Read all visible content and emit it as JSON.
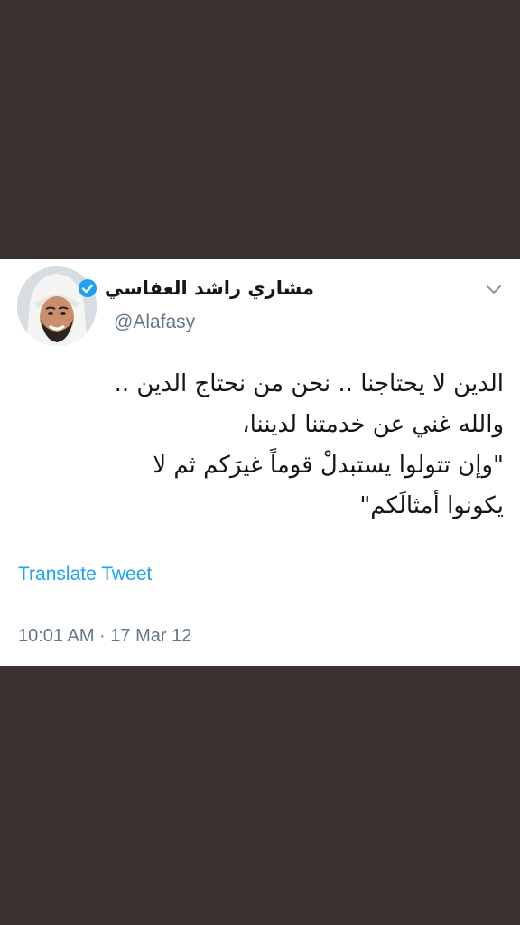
{
  "tweet": {
    "display_name": "مشاري راشد العفاسي",
    "handle": "@Alafasy",
    "verified_icon": "verified-badge-icon",
    "menu_icon": "chevron-down-icon",
    "body_lines": [
      "الدين لا يحتاجنا .. نحن من نحتاج الدين ..",
      "والله غني عن خدمتنا لديننا،",
      "\"وإن تتولوا يستبدلْ قوماً غيرَكم ثم لا",
      "يكونوا أمثالَكم\""
    ],
    "translate_label": "Translate Tweet",
    "timestamp": "10:01 AM · 17 Mar 12"
  },
  "colors": {
    "background": "#3a3230",
    "card": "#ffffff",
    "accent": "#1da1f2",
    "secondary_text": "#657786",
    "primary_text": "#14171a"
  }
}
